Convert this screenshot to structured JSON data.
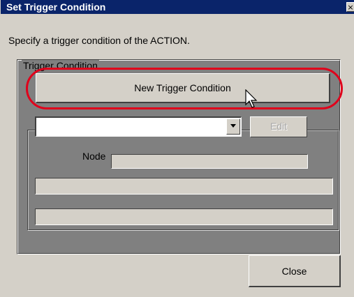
{
  "window": {
    "title": "Set Trigger Condition",
    "close_glyph": "×"
  },
  "instruction": "Specify a trigger condition of the ACTION.",
  "group": {
    "label": "Trigger Condition",
    "new_button_label": "New Trigger Condition",
    "combo_value": "",
    "combo_arrow_icon": "chevron-down-icon",
    "edit_button_label": "Edit",
    "node_label": "Node",
    "node_value": "",
    "field1_value": "",
    "field2_value": ""
  },
  "footer": {
    "close_button_label": "Close"
  },
  "colors": {
    "titlebar": "#0a246a",
    "dialog_bg": "#d4d0c8",
    "group_bg": "#808080",
    "highlight": "#e0001b"
  }
}
